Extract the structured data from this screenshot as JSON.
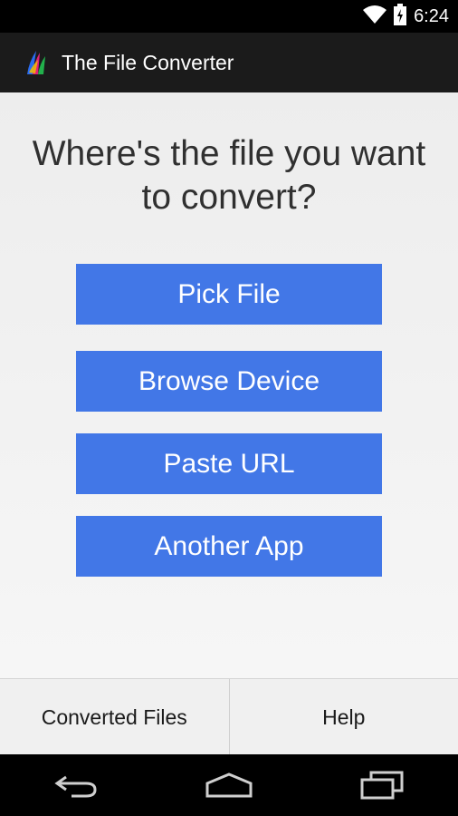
{
  "status_bar": {
    "time": "6:24",
    "icons": [
      "wifi-icon",
      "battery-icon"
    ]
  },
  "app_bar": {
    "title": "The File Converter",
    "logo": "app-logo-icon"
  },
  "main": {
    "prompt_line1": "Where's the file you want",
    "prompt_line2": "to convert?",
    "buttons": [
      {
        "label": "Pick File"
      },
      {
        "label": "Browse Device"
      },
      {
        "label": "Paste URL"
      },
      {
        "label": "Another App"
      }
    ]
  },
  "bottom_bar": {
    "left_label": "Converted Files",
    "right_label": "Help"
  },
  "nav_bar": {
    "icons": [
      "back-icon",
      "home-icon",
      "recents-icon"
    ]
  },
  "colors": {
    "accent": "#4277e7",
    "app_bar": "#1b1b1b"
  }
}
